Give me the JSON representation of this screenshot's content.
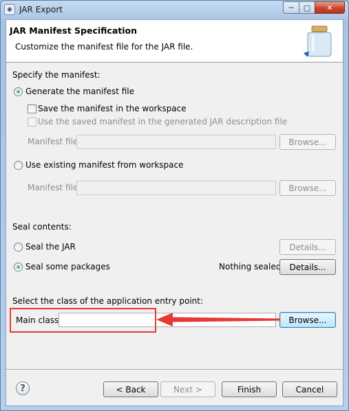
{
  "window": {
    "title": "JAR Export",
    "app_icon": "eclipse-icon"
  },
  "banner": {
    "title": "JAR Manifest Specification",
    "description": "Customize the manifest file for the JAR file.",
    "icon": "jar-icon"
  },
  "manifest": {
    "section_label": "Specify the manifest:",
    "generate_label": "Generate the manifest file",
    "generate_selected": true,
    "save_label": "Save the manifest in the workspace",
    "save_checked": false,
    "use_saved_label": "Use the saved manifest in the generated JAR description file",
    "use_saved_checked": false,
    "manifest_file_label": "Manifest file:",
    "manifest_file_value": "",
    "browse_label": "Browse...",
    "use_existing_label": "Use existing manifest from workspace",
    "use_existing_selected": false,
    "manifest_file_label_2": "Manifest file:",
    "manifest_file_value_2": "",
    "browse_label_2": "Browse..."
  },
  "seal": {
    "section_label": "Seal contents:",
    "seal_jar_label": "Seal the JAR",
    "seal_jar_selected": false,
    "details_label_1": "Details...",
    "seal_packages_label": "Seal some packages",
    "seal_packages_selected": true,
    "status_text": "Nothing sealed",
    "details_label_2": "Details..."
  },
  "entry_point": {
    "section_label": "Select the class of the application entry point:",
    "main_class_label": "Main class:",
    "main_class_value": "",
    "browse_label": "Browse..."
  },
  "footer": {
    "help_icon": "help-icon",
    "back_label": "< Back",
    "next_label": "Next >",
    "finish_label": "Finish",
    "cancel_label": "Cancel"
  },
  "colors": {
    "annotation": "#e53935",
    "disabled_text": "#8d8d8d",
    "focus_border": "#3c7fb1"
  }
}
